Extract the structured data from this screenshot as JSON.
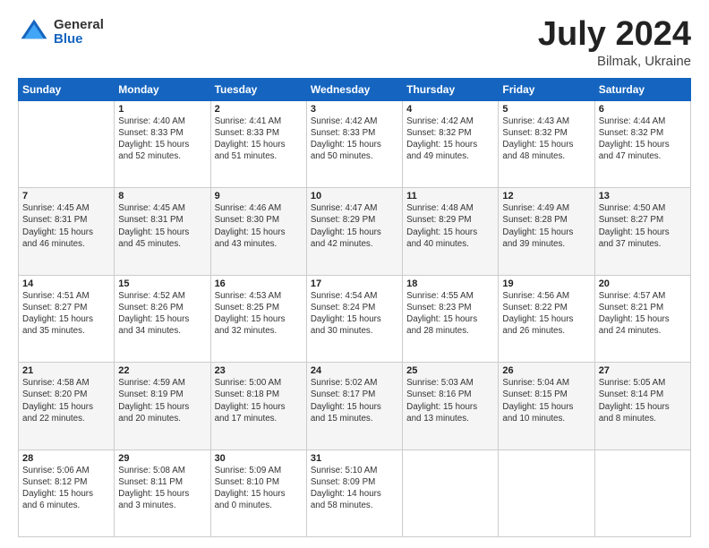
{
  "logo": {
    "general": "General",
    "blue": "Blue"
  },
  "title": {
    "month": "July 2024",
    "location": "Bilmak, Ukraine"
  },
  "header_days": [
    "Sunday",
    "Monday",
    "Tuesday",
    "Wednesday",
    "Thursday",
    "Friday",
    "Saturday"
  ],
  "weeks": [
    [
      {
        "day": "",
        "info": ""
      },
      {
        "day": "1",
        "info": "Sunrise: 4:40 AM\nSunset: 8:33 PM\nDaylight: 15 hours\nand 52 minutes."
      },
      {
        "day": "2",
        "info": "Sunrise: 4:41 AM\nSunset: 8:33 PM\nDaylight: 15 hours\nand 51 minutes."
      },
      {
        "day": "3",
        "info": "Sunrise: 4:42 AM\nSunset: 8:33 PM\nDaylight: 15 hours\nand 50 minutes."
      },
      {
        "day": "4",
        "info": "Sunrise: 4:42 AM\nSunset: 8:32 PM\nDaylight: 15 hours\nand 49 minutes."
      },
      {
        "day": "5",
        "info": "Sunrise: 4:43 AM\nSunset: 8:32 PM\nDaylight: 15 hours\nand 48 minutes."
      },
      {
        "day": "6",
        "info": "Sunrise: 4:44 AM\nSunset: 8:32 PM\nDaylight: 15 hours\nand 47 minutes."
      }
    ],
    [
      {
        "day": "7",
        "info": "Sunrise: 4:45 AM\nSunset: 8:31 PM\nDaylight: 15 hours\nand 46 minutes."
      },
      {
        "day": "8",
        "info": "Sunrise: 4:45 AM\nSunset: 8:31 PM\nDaylight: 15 hours\nand 45 minutes."
      },
      {
        "day": "9",
        "info": "Sunrise: 4:46 AM\nSunset: 8:30 PM\nDaylight: 15 hours\nand 43 minutes."
      },
      {
        "day": "10",
        "info": "Sunrise: 4:47 AM\nSunset: 8:29 PM\nDaylight: 15 hours\nand 42 minutes."
      },
      {
        "day": "11",
        "info": "Sunrise: 4:48 AM\nSunset: 8:29 PM\nDaylight: 15 hours\nand 40 minutes."
      },
      {
        "day": "12",
        "info": "Sunrise: 4:49 AM\nSunset: 8:28 PM\nDaylight: 15 hours\nand 39 minutes."
      },
      {
        "day": "13",
        "info": "Sunrise: 4:50 AM\nSunset: 8:27 PM\nDaylight: 15 hours\nand 37 minutes."
      }
    ],
    [
      {
        "day": "14",
        "info": "Sunrise: 4:51 AM\nSunset: 8:27 PM\nDaylight: 15 hours\nand 35 minutes."
      },
      {
        "day": "15",
        "info": "Sunrise: 4:52 AM\nSunset: 8:26 PM\nDaylight: 15 hours\nand 34 minutes."
      },
      {
        "day": "16",
        "info": "Sunrise: 4:53 AM\nSunset: 8:25 PM\nDaylight: 15 hours\nand 32 minutes."
      },
      {
        "day": "17",
        "info": "Sunrise: 4:54 AM\nSunset: 8:24 PM\nDaylight: 15 hours\nand 30 minutes."
      },
      {
        "day": "18",
        "info": "Sunrise: 4:55 AM\nSunset: 8:23 PM\nDaylight: 15 hours\nand 28 minutes."
      },
      {
        "day": "19",
        "info": "Sunrise: 4:56 AM\nSunset: 8:22 PM\nDaylight: 15 hours\nand 26 minutes."
      },
      {
        "day": "20",
        "info": "Sunrise: 4:57 AM\nSunset: 8:21 PM\nDaylight: 15 hours\nand 24 minutes."
      }
    ],
    [
      {
        "day": "21",
        "info": "Sunrise: 4:58 AM\nSunset: 8:20 PM\nDaylight: 15 hours\nand 22 minutes."
      },
      {
        "day": "22",
        "info": "Sunrise: 4:59 AM\nSunset: 8:19 PM\nDaylight: 15 hours\nand 20 minutes."
      },
      {
        "day": "23",
        "info": "Sunrise: 5:00 AM\nSunset: 8:18 PM\nDaylight: 15 hours\nand 17 minutes."
      },
      {
        "day": "24",
        "info": "Sunrise: 5:02 AM\nSunset: 8:17 PM\nDaylight: 15 hours\nand 15 minutes."
      },
      {
        "day": "25",
        "info": "Sunrise: 5:03 AM\nSunset: 8:16 PM\nDaylight: 15 hours\nand 13 minutes."
      },
      {
        "day": "26",
        "info": "Sunrise: 5:04 AM\nSunset: 8:15 PM\nDaylight: 15 hours\nand 10 minutes."
      },
      {
        "day": "27",
        "info": "Sunrise: 5:05 AM\nSunset: 8:14 PM\nDaylight: 15 hours\nand 8 minutes."
      }
    ],
    [
      {
        "day": "28",
        "info": "Sunrise: 5:06 AM\nSunset: 8:12 PM\nDaylight: 15 hours\nand 6 minutes."
      },
      {
        "day": "29",
        "info": "Sunrise: 5:08 AM\nSunset: 8:11 PM\nDaylight: 15 hours\nand 3 minutes."
      },
      {
        "day": "30",
        "info": "Sunrise: 5:09 AM\nSunset: 8:10 PM\nDaylight: 15 hours\nand 0 minutes."
      },
      {
        "day": "31",
        "info": "Sunrise: 5:10 AM\nSunset: 8:09 PM\nDaylight: 14 hours\nand 58 minutes."
      },
      {
        "day": "",
        "info": ""
      },
      {
        "day": "",
        "info": ""
      },
      {
        "day": "",
        "info": ""
      }
    ]
  ]
}
